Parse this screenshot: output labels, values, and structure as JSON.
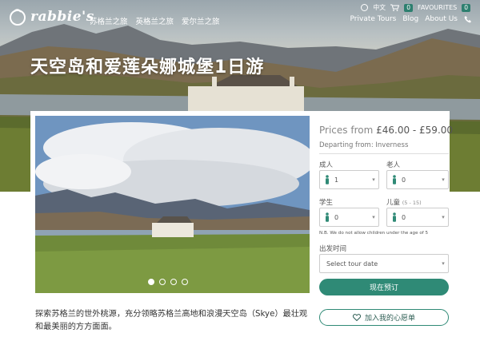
{
  "brand": {
    "name": "rabbie's"
  },
  "top_nav": [
    "苏格兰之旅",
    "英格兰之旅",
    "爱尔兰之旅"
  ],
  "utility": {
    "language": "中文",
    "cart_count": "0",
    "favourites_label": "FAVOURITES",
    "favourites_count": "0"
  },
  "main_nav": [
    "Private Tours",
    "Blog",
    "About Us"
  ],
  "hero": {
    "title": "天空岛和爱莲朵娜城堡1日游"
  },
  "booking": {
    "price_label": "Prices from",
    "price_value": "£46.00 - £59.00",
    "departing": "Departing from: Inverness",
    "adult_label": "成人",
    "adult_value": "1",
    "senior_label": "老人",
    "senior_value": "0",
    "student_label": "学生",
    "student_value": "0",
    "child_label": "儿童",
    "child_range": "(5 - 15)",
    "child_value": "0",
    "note": "N.B. We do not allow children under the age of 5",
    "date_label": "出发时间",
    "date_placeholder": "Select tour date",
    "book_button": "现在预订",
    "wishlist_button": "加入我的心愿单"
  },
  "gallery": {
    "slides": 4,
    "active_slide": 1
  },
  "description": "探索苏格兰的世外桃源，充分领略苏格兰高地和浪漫天空岛（Skye）最壮观和最美丽的方方面面。",
  "colors": {
    "accent": "#2f8a76",
    "text": "#333333"
  },
  "icons": [
    "rabbit-logo-icon",
    "globe-icon",
    "cart-icon",
    "phone-icon",
    "person-icon",
    "heart-icon",
    "chevron-down-icon"
  ]
}
